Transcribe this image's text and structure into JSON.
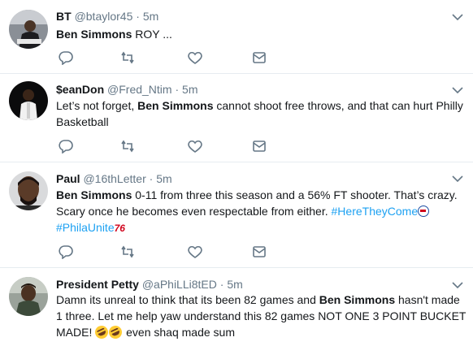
{
  "tweets": [
    {
      "name": "BT",
      "handle": "@btaylor45",
      "separator": "·",
      "time": "5m",
      "body_bold": "Ben Simmons",
      "body_rest": " ROY ..."
    },
    {
      "name": "$eanDon",
      "handle": "@Fred_Ntim",
      "separator": "·",
      "time": "5m",
      "body_pre": "Let’s not forget, ",
      "body_bold": "Ben Simmons",
      "body_rest": " cannot shoot free throws, and that can hurt Philly Basketball"
    },
    {
      "name": "Paul",
      "handle": "@16thLetter",
      "separator": "·",
      "time": "5m",
      "body_bold": "Ben Simmons",
      "body_rest": " 0-11 from three this season and a 56% FT shooter. That’s crazy. Scary once he becomes even respectable from either. ",
      "hashtag1": "#HereTheyCome",
      "hashtag2": "#PhilaUnite",
      "emoji_76": "76"
    },
    {
      "name": "President Petty",
      "handle": "@aPhiLLi8tED",
      "separator": "·",
      "time": "5m",
      "body_pre": "Damn its unreal to think that its been 82 games and ",
      "body_bold": "Ben Simmons",
      "body_rest": " hasn't made 1 three. Let me help yaw understand this 82 games NOT ONE 3 POINT BUCKET MADE! ",
      "body_tail": " even shaq made sum"
    }
  ],
  "icons": {
    "reply": "reply-icon",
    "retweet": "retweet-icon",
    "like": "heart-icon",
    "message": "envelope-icon",
    "menu": "chevron-down-icon"
  },
  "colors": {
    "text": "#14171a",
    "muted": "#657786",
    "link": "#1da1f2",
    "divider": "#e6ecf0"
  }
}
